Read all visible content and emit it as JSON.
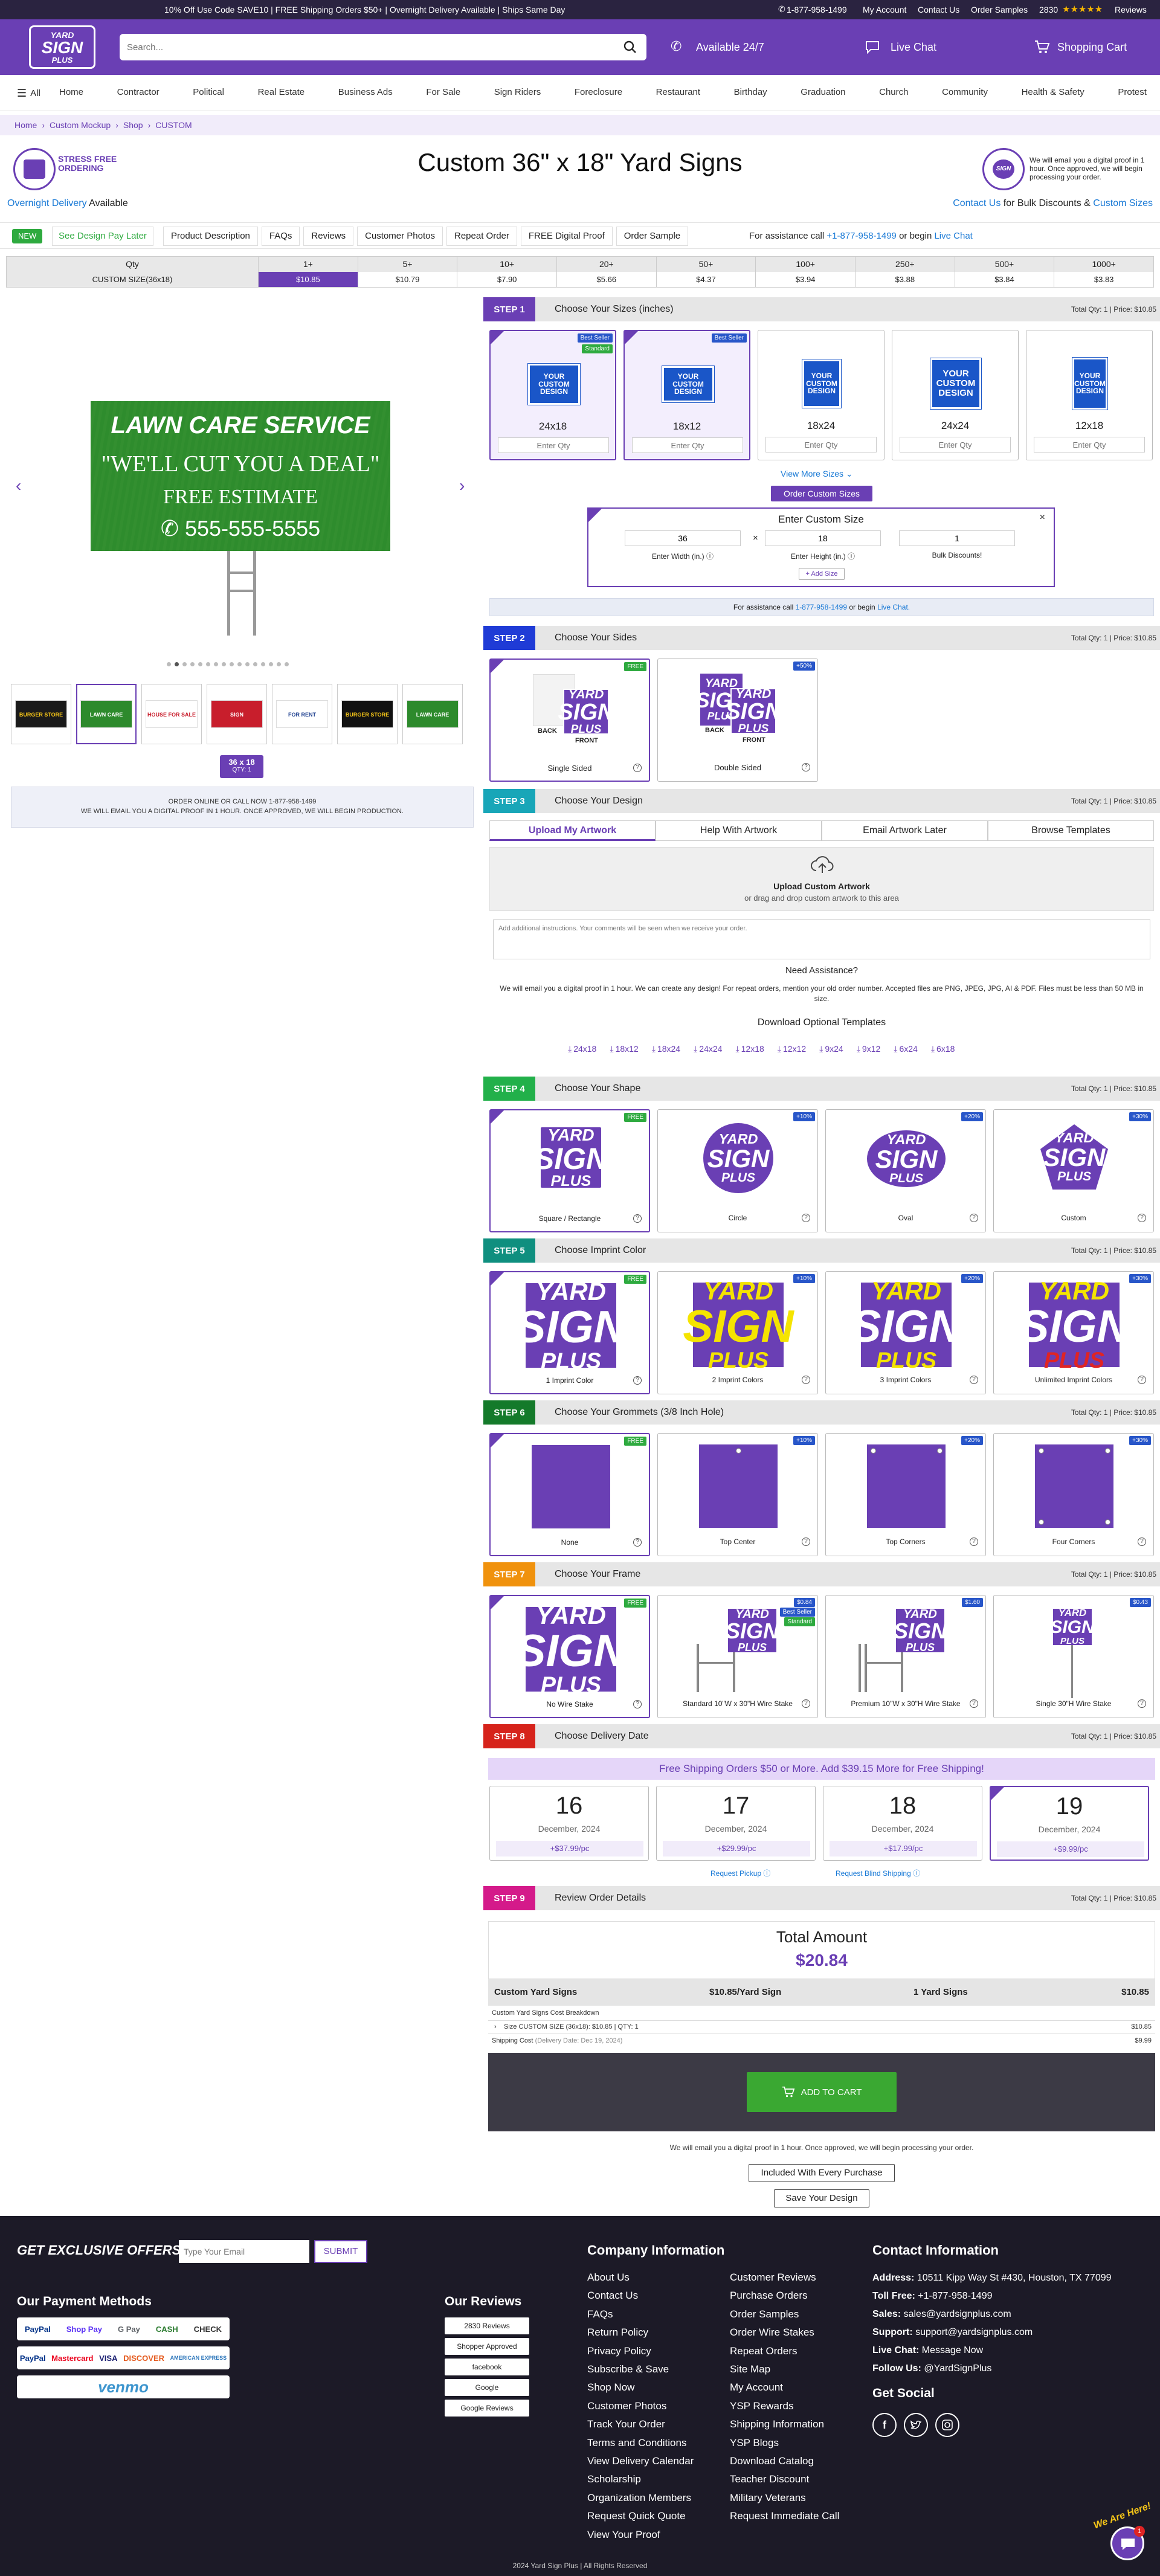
{
  "promo_bar": {
    "text": "10% Off Use Code SAVE10 | FREE Shipping Orders $50+ | Overnight Delivery Available | Ships Same Day",
    "phone": "1-877-958-1499",
    "my_account": "My Account",
    "contact": "Contact Us",
    "samples": "Order Samples",
    "reviews_count": "2830",
    "stars": "★★★★★",
    "reviews": "Reviews"
  },
  "header": {
    "logo_top": "YARD",
    "logo_mid": "SIGN",
    "logo_bot": "PLUS",
    "search_placeholder": "Search...",
    "available": "Available 24/7",
    "live_chat": "Live Chat",
    "cart": "Shopping Cart"
  },
  "nav": {
    "all": "All",
    "items": [
      "Home",
      "Contractor",
      "Political",
      "Real Estate",
      "Business Ads",
      "For Sale",
      "Sign Riders",
      "Foreclosure",
      "Restaurant",
      "Birthday",
      "Graduation",
      "Church",
      "Community",
      "Health & Safety",
      "Protest"
    ]
  },
  "breadcrumb": [
    "Home",
    "Custom Mockup",
    "Shop",
    "CUSTOM"
  ],
  "product": {
    "stress_free": "STRESS FREE ORDERING",
    "title": "Custom 36\" x 18\" Yard Signs",
    "proof_note": "We will email you a digital proof in 1 hour. Once approved, we will begin processing your order.",
    "overnight": "Overnight Delivery",
    "available": "Available",
    "contact_us": "Contact Us",
    "bulk_text": "for Bulk Discounts &",
    "custom_sizes": "Custom Sizes"
  },
  "tabs": {
    "new": "NEW",
    "pay_later": "See Design Pay Later",
    "items": [
      "Product Description",
      "FAQs",
      "Reviews",
      "Customer Photos",
      "Repeat Order",
      "FREE Digital Proof",
      "Order Sample"
    ],
    "assist": "For assistance call",
    "phone": "+1-877-958-1499",
    "or": "or begin",
    "chat": "Live Chat"
  },
  "price_table": {
    "qty_label": "Qty",
    "size_label": "CUSTOM SIZE(36x18)",
    "qtys": [
      "1+",
      "5+",
      "10+",
      "20+",
      "50+",
      "100+",
      "250+",
      "500+",
      "1000+"
    ],
    "prices": [
      "$10.85",
      "$10.79",
      "$7.90",
      "$5.66",
      "$4.37",
      "$3.94",
      "$3.88",
      "$3.84",
      "$3.83"
    ]
  },
  "gallery": {
    "main_line1": "LAWN CARE SERVICE",
    "main_line2": "\"WE'LL CUT YOU A DEAL\"",
    "main_line3": "FREE ESTIMATE",
    "main_line4": "555-555-5555",
    "size_tag": "36 x 18",
    "qty_tag": "QTY: 1",
    "order_line1": "ORDER ONLINE OR CALL NOW 1-877-958-1499",
    "order_line2": "WE WILL EMAIL YOU A DIGITAL PROOF IN 1 HOUR. ONCE APPROVED, WE WILL BEGIN PRODUCTION.",
    "thumbs": [
      "BURGER STORE",
      "LAWN CARE",
      "HOUSE FOR SALE",
      "SIGN",
      "FOR RENT",
      "BURGER STORE",
      "LAWN CARE"
    ]
  },
  "total_label": "Total Qty: 1 | Price: $10.85",
  "steps": [
    {
      "tag": "STEP 1",
      "title": "Choose Your Sizes (inches)",
      "color": "#6a3fb4"
    },
    {
      "tag": "STEP 2",
      "title": "Choose Your Sides",
      "color": "#1f3bd6"
    },
    {
      "tag": "STEP 3",
      "title": "Choose Your Design",
      "color": "#18a6b8"
    },
    {
      "tag": "STEP 4",
      "title": "Choose Your Shape",
      "color": "#22b04a"
    },
    {
      "tag": "STEP 5",
      "title": "Choose Imprint Color",
      "color": "#0f8f7f"
    },
    {
      "tag": "STEP 6",
      "title": "Choose Your Grommets (3/8 Inch Hole)",
      "color": "#147a2a"
    },
    {
      "tag": "STEP 7",
      "title": "Choose Your Frame",
      "color": "#f0920d"
    },
    {
      "tag": "STEP 8",
      "title": "Choose Delivery Date",
      "color": "#d6231b"
    },
    {
      "tag": "STEP 9",
      "title": "Review Order Details",
      "color": "#d41a8a"
    }
  ],
  "sizes": {
    "cards": [
      {
        "label": "24x18",
        "badge": "Best Seller",
        "badge2": "Standard"
      },
      {
        "label": "18x12",
        "badge": "Best Seller",
        "badge2": ""
      },
      {
        "label": "18x24",
        "badge": "",
        "badge2": ""
      },
      {
        "label": "24x24",
        "badge": "",
        "badge2": ""
      },
      {
        "label": "12x18",
        "badge": "",
        "badge2": ""
      }
    ],
    "design_text": "YOUR CUSTOM DESIGN",
    "enter_qty": "Enter Qty",
    "view_more": "View More Sizes",
    "order_custom": "Order Custom Sizes",
    "custom_title": "Enter Custom Size",
    "width_val": "36",
    "height_val": "18",
    "bulk_val": "1",
    "x": "×",
    "width_label": "Enter Width (in.)",
    "height_label": "Enter Height (in.)",
    "bulk_label": "Bulk Discounts!",
    "add_size": "+ Add Size",
    "assist": "For assistance call",
    "phone": "1-877-958-1499",
    "or": "or begin",
    "chat": "Live Chat."
  },
  "sides": {
    "cards": [
      {
        "label": "Single Sided",
        "badge": "FREE"
      },
      {
        "label": "Double Sided",
        "badge": "+50%"
      }
    ],
    "back": "BACK",
    "front": "FRONT"
  },
  "design": {
    "tabs": [
      "Upload My Artwork",
      "Help With Artwork",
      "Email Artwork Later",
      "Browse Templates"
    ],
    "upload_title": "Upload Custom Artwork",
    "upload_sub": "or drag and drop custom artwork to this area",
    "instructions_placeholder": "Add additional instructions. Your comments will be seen when we receive your order.",
    "need_assist": "Need Assistance?",
    "assist_text": "We will email you a digital proof in 1 hour. We can create any design! For repeat orders, mention your old order number. Accepted files are PNG, JPEG, JPG, AI & PDF. Files must be less than 50 MB in size.",
    "download_title": "Download Optional Templates",
    "templates": [
      "24x18",
      "18x12",
      "18x24",
      "24x24",
      "12x18",
      "12x12",
      "9x24",
      "9x12",
      "6x24",
      "6x18"
    ]
  },
  "shape": {
    "cards": [
      {
        "label": "Square / Rectangle",
        "badge": "FREE"
      },
      {
        "label": "Circle",
        "badge": "+10%"
      },
      {
        "label": "Oval",
        "badge": "+20%"
      },
      {
        "label": "Custom",
        "badge": "+30%"
      }
    ]
  },
  "imprint": {
    "cards": [
      {
        "label": "1 Imprint Color",
        "badge": "FREE"
      },
      {
        "label": "2 Imprint Colors",
        "badge": "+10%"
      },
      {
        "label": "3 Imprint Colors",
        "badge": "+20%"
      },
      {
        "label": "Unlimited Imprint Colors",
        "badge": "+30%"
      }
    ]
  },
  "grommets": {
    "cards": [
      {
        "label": "None",
        "badge": "FREE"
      },
      {
        "label": "Top Center",
        "badge": "+10%"
      },
      {
        "label": "Top Corners",
        "badge": "+20%"
      },
      {
        "label": "Four Corners",
        "badge": "+30%"
      }
    ]
  },
  "frame": {
    "cards": [
      {
        "label": "No Wire Stake",
        "badge": "FREE",
        "badge2": ""
      },
      {
        "label": "Standard 10\"W x 30\"H Wire Stake",
        "badge": "$0.84",
        "badge2": "Best Seller",
        "badge3": "Standard"
      },
      {
        "label": "Premium 10\"W x 30\"H Wire Stake",
        "badge": "$1.60",
        "badge2": ""
      },
      {
        "label": "Single 30\"H Wire Stake",
        "badge": "$0.43",
        "badge2": ""
      }
    ]
  },
  "delivery": {
    "banner": "Free Shipping Orders $50 or More. Add $39.15 More for Free Shipping!",
    "dates": [
      {
        "day": "16",
        "month": "December, 2024",
        "price": "+$37.99/pc"
      },
      {
        "day": "17",
        "month": "December, 2024",
        "price": "+$29.99/pc"
      },
      {
        "day": "18",
        "month": "December, 2024",
        "price": "+$17.99/pc"
      },
      {
        "day": "19",
        "month": "December, 2024",
        "price": "+$9.99/pc"
      }
    ],
    "pickup": "Request Pickup",
    "blind": "Request Blind Shipping"
  },
  "review": {
    "total_label": "Total Amount",
    "total": "$20.84",
    "product": "Custom Yard Signs",
    "unit": "$10.85/Yard Sign",
    "count": "1 Yard Signs",
    "line_total": "$10.85",
    "breakdown_title": "Custom Yard Signs Cost Breakdown",
    "breakdown_row": "Size CUSTOM SIZE (36x18): $10.85 | QTY: 1",
    "breakdown_val": "$10.85",
    "shipping_label": "Shipping Cost",
    "shipping_date": "(Delivery Date: Dec 19, 2024)",
    "shipping_val": "$9.99",
    "add_to_cart": "ADD TO CART",
    "proof_note": "We will email you a digital proof in 1 hour. Once approved, we will begin processing your order.",
    "included": "Included With Every Purchase",
    "save": "Save Your Design"
  },
  "footer": {
    "offers": "GET EXCLUSIVE OFFERS",
    "email_placeholder": "Type Your Email",
    "submit": "SUBMIT",
    "payment_title": "Our Payment Methods",
    "payments": [
      "PayPal",
      "Shop Pay",
      "G Pay",
      "CASH",
      "CHECK",
      "PayPal",
      "Mastercard",
      "VISA",
      "DISCOVER",
      "AMERICAN EXPRESS",
      "venmo"
    ],
    "reviews_title": "Our Reviews",
    "review_badges": [
      "2830 Reviews",
      "Shopper Approved",
      "facebook",
      "Google",
      "Google Reviews"
    ],
    "company_title": "Company Information",
    "col1": [
      "About Us",
      "Contact Us",
      "FAQs",
      "Return Policy",
      "Privacy Policy",
      "Subscribe & Save",
      "Shop Now",
      "Customer Photos",
      "Track Your Order",
      "Terms and Conditions",
      "View Delivery Calendar",
      "Scholarship",
      "Organization Members",
      "Request Quick Quote",
      "View Your Proof"
    ],
    "col2": [
      "Customer Reviews",
      "Purchase Orders",
      "Order Samples",
      "Order Wire Stakes",
      "Repeat Orders",
      "Site Map",
      "My Account",
      "YSP Rewards",
      "Shipping Information",
      "YSP Blogs",
      "Download Catalog",
      "Teacher Discount",
      "Military Veterans",
      "Request Immediate Call"
    ],
    "contact_title": "Contact Information",
    "contact": [
      {
        "k": "Address:",
        "v": "10511 Kipp Way St #430, Houston, TX 77099"
      },
      {
        "k": "Toll Free:",
        "v": "+1-877-958-1499"
      },
      {
        "k": "Sales:",
        "v": "sales@yardsignplus.com"
      },
      {
        "k": "Support:",
        "v": "support@yardsignplus.com"
      },
      {
        "k": "Live Chat:",
        "v": "Message Now"
      },
      {
        "k": "Follow Us:",
        "v": "@YardSignPlus"
      }
    ],
    "social_title": "Get Social",
    "copyright": "2024 Yard Sign Plus | All Rights Reserved",
    "we_are_here": "We Are Here!",
    "chat_count": "1"
  },
  "colors": {
    "brand": "#6a3fb4",
    "dark": "#2a2340",
    "green": "#2eaa3f",
    "blue": "#1a7ad6",
    "cart_green": "#3aa832"
  }
}
